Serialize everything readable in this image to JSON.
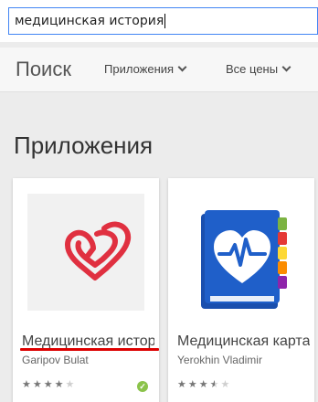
{
  "search": {
    "value": "медицинская история"
  },
  "nav": {
    "title": "Поиск",
    "categories_label": "Приложения",
    "price_label": "Все цены"
  },
  "section": {
    "title": "Приложения"
  },
  "apps": [
    {
      "name": "Медицинская история",
      "developer": "Garipov Bulat",
      "icon": "heart-paperclip-icon",
      "rating_stars": 4,
      "verified": true
    },
    {
      "name": "Медицинская карта",
      "developer": "Yerokhin Vladimir",
      "icon": "medical-book-heart-icon",
      "rating_stars": 3.5
    }
  ],
  "colors": {
    "accent": "#4285f4",
    "heart_red": "#e03040",
    "book_blue": "#1f5fc9",
    "verified_green": "#8bc34a",
    "underline_red": "#dd0000"
  }
}
